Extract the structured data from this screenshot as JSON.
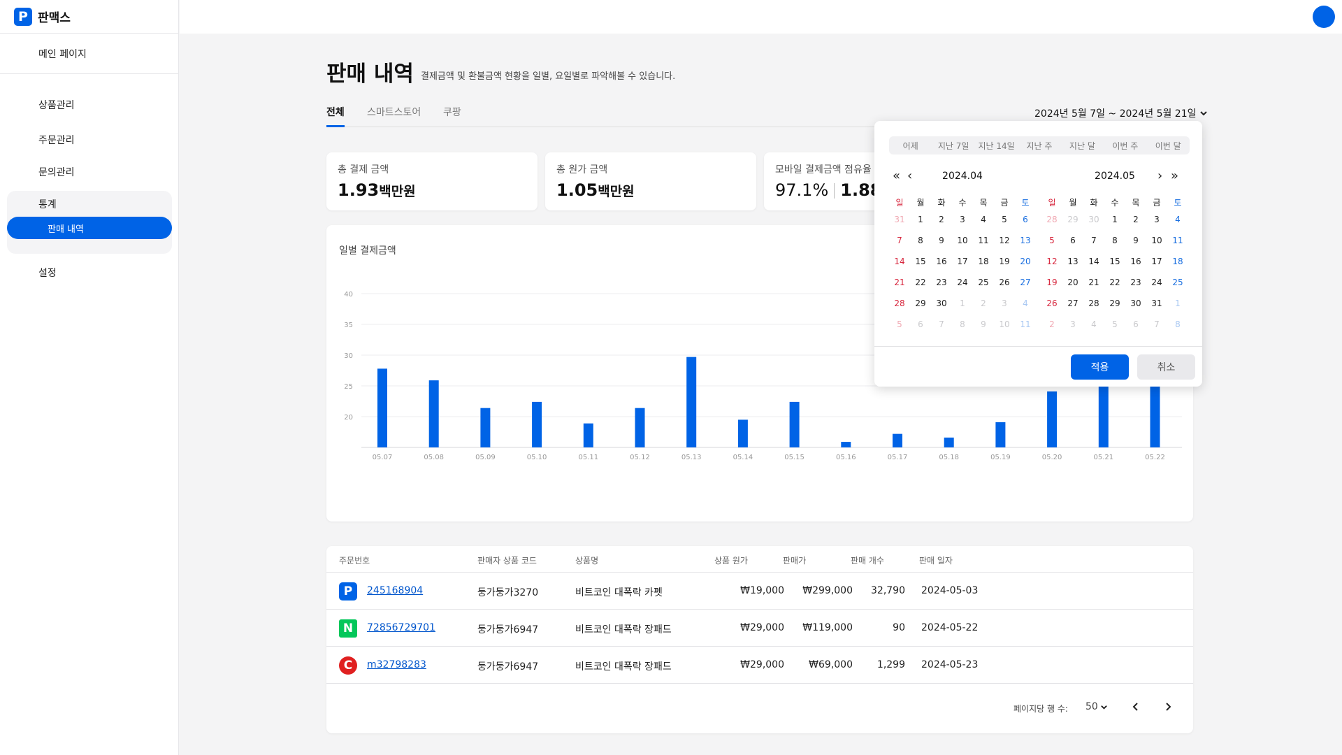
{
  "brand": {
    "name": "판맥스",
    "logo_letter": "P",
    "color": "#0063e6"
  },
  "sidebar": {
    "main": "메인 페이지",
    "items": [
      "상품관리",
      "주문관리",
      "문의관리"
    ],
    "group_label": "통계",
    "active_sub": "판매 내역",
    "settings": "설정"
  },
  "page": {
    "title": "판매 내역",
    "subtitle": "결제금액 및 환불금액 현황을 일별, 요일별로 파악해볼 수 있습니다.",
    "tabs": [
      "전체",
      "스마트스토어",
      "쿠팡"
    ],
    "active_tab": 0,
    "date_range": "2024년 5월 7일 ~ 2024년 5월 21일"
  },
  "cards": [
    {
      "label": "총 결제 금액",
      "value": "1.93",
      "unit": "백만원"
    },
    {
      "label": "총 원가 금액",
      "value": "1.05",
      "unit": "백만원"
    },
    {
      "label": "모바일 결제금액 점유율",
      "value": "97.1%",
      "value2": "1.88"
    }
  ],
  "chart_data": {
    "type": "bar",
    "title": "일별 결제금액",
    "categories": [
      "05.07",
      "05.08",
      "05.09",
      "05.10",
      "05.11",
      "05.12",
      "05.13",
      "05.14",
      "05.15",
      "05.16",
      "05.17",
      "05.18",
      "05.19",
      "05.20",
      "05.21",
      "05.22"
    ],
    "values": [
      27.8,
      25.9,
      21.4,
      22.4,
      18.9,
      21.4,
      29.7,
      19.5,
      22.4,
      15.9,
      17.2,
      16.6,
      19.1,
      24.1,
      30.5,
      33.5
    ],
    "ylim": [
      15,
      40
    ],
    "yticks": [
      20,
      25,
      30,
      35,
      40
    ],
    "grid": true,
    "color": "#0063e6"
  },
  "table": {
    "headers": [
      "주문번호",
      "판매자 상품 코드",
      "상품명",
      "상품 원가",
      "판매가",
      "판매 개수",
      "판매 일자"
    ],
    "rows": [
      {
        "channel_icon": "P",
        "order_no": "245168904",
        "code": "둥가둥가3270",
        "name": "비트코인 대폭락 카펫",
        "cost": "₩19,000",
        "price": "₩299,000",
        "qty": "32,790",
        "date": "2024-05-03"
      },
      {
        "channel_icon": "N",
        "order_no": "72856729701",
        "code": "둥가둥가6947",
        "name": "비트코인 대폭락 장패드",
        "cost": "₩29,000",
        "price": "₩119,000",
        "qty": "90",
        "date": "2024-05-22"
      },
      {
        "channel_icon": "C",
        "order_no": "m32798283",
        "code": "둥가둥가6947",
        "name": "비트코인 대폭락 장패드",
        "cost": "₩29,000",
        "price": "₩69,000",
        "qty": "1,299",
        "date": "2024-05-23"
      }
    ],
    "rows_per_page_label": "페이지당 행 수:",
    "rows_per_page": "50"
  },
  "datepicker": {
    "presets": [
      "어제",
      "지난 7일",
      "지난 14일",
      "지난 주",
      "지난 달",
      "이번 주",
      "이번 달"
    ],
    "weekdays": [
      "일",
      "월",
      "화",
      "수",
      "목",
      "금",
      "토"
    ],
    "left_month": "2024.04",
    "right_month": "2024.05",
    "left_weeks": [
      [
        [
          "31",
          1
        ],
        [
          "1",
          0
        ],
        [
          "2",
          0
        ],
        [
          "3",
          0
        ],
        [
          "4",
          0
        ],
        [
          "5",
          0
        ],
        [
          "6",
          0
        ]
      ],
      [
        [
          "7",
          0
        ],
        [
          "8",
          0
        ],
        [
          "9",
          0
        ],
        [
          "10",
          0
        ],
        [
          "11",
          0
        ],
        [
          "12",
          0
        ],
        [
          "13",
          0
        ]
      ],
      [
        [
          "14",
          0
        ],
        [
          "15",
          0
        ],
        [
          "16",
          0
        ],
        [
          "17",
          0
        ],
        [
          "18",
          0
        ],
        [
          "19",
          0
        ],
        [
          "20",
          0
        ]
      ],
      [
        [
          "21",
          0
        ],
        [
          "22",
          0
        ],
        [
          "23",
          0
        ],
        [
          "24",
          0
        ],
        [
          "25",
          0
        ],
        [
          "26",
          0
        ],
        [
          "27",
          0
        ]
      ],
      [
        [
          "28",
          0
        ],
        [
          "29",
          0
        ],
        [
          "30",
          0
        ],
        [
          "1",
          1
        ],
        [
          "2",
          1
        ],
        [
          "3",
          1
        ],
        [
          "4",
          1
        ]
      ],
      [
        [
          "5",
          1
        ],
        [
          "6",
          1
        ],
        [
          "7",
          1
        ],
        [
          "8",
          1
        ],
        [
          "9",
          1
        ],
        [
          "10",
          1
        ],
        [
          "11",
          1
        ]
      ]
    ],
    "right_weeks": [
      [
        [
          "28",
          1
        ],
        [
          "29",
          1
        ],
        [
          "30",
          1
        ],
        [
          "1",
          0
        ],
        [
          "2",
          0
        ],
        [
          "3",
          0
        ],
        [
          "4",
          0
        ]
      ],
      [
        [
          "5",
          0
        ],
        [
          "6",
          0
        ],
        [
          "7",
          0
        ],
        [
          "8",
          0
        ],
        [
          "9",
          0
        ],
        [
          "10",
          0
        ],
        [
          "11",
          0
        ]
      ],
      [
        [
          "12",
          0
        ],
        [
          "13",
          0
        ],
        [
          "14",
          0
        ],
        [
          "15",
          0
        ],
        [
          "16",
          0
        ],
        [
          "17",
          0
        ],
        [
          "18",
          0
        ]
      ],
      [
        [
          "19",
          0
        ],
        [
          "20",
          0
        ],
        [
          "21",
          0
        ],
        [
          "22",
          0
        ],
        [
          "23",
          0
        ],
        [
          "24",
          0
        ],
        [
          "25",
          0
        ]
      ],
      [
        [
          "26",
          0
        ],
        [
          "27",
          0
        ],
        [
          "28",
          0
        ],
        [
          "29",
          0
        ],
        [
          "30",
          0
        ],
        [
          "31",
          0
        ],
        [
          "1",
          1
        ]
      ],
      [
        [
          "2",
          1
        ],
        [
          "3",
          1
        ],
        [
          "4",
          1
        ],
        [
          "5",
          1
        ],
        [
          "6",
          1
        ],
        [
          "7",
          1
        ],
        [
          "8",
          1
        ]
      ]
    ],
    "apply_label": "적용",
    "cancel_label": "취소"
  }
}
